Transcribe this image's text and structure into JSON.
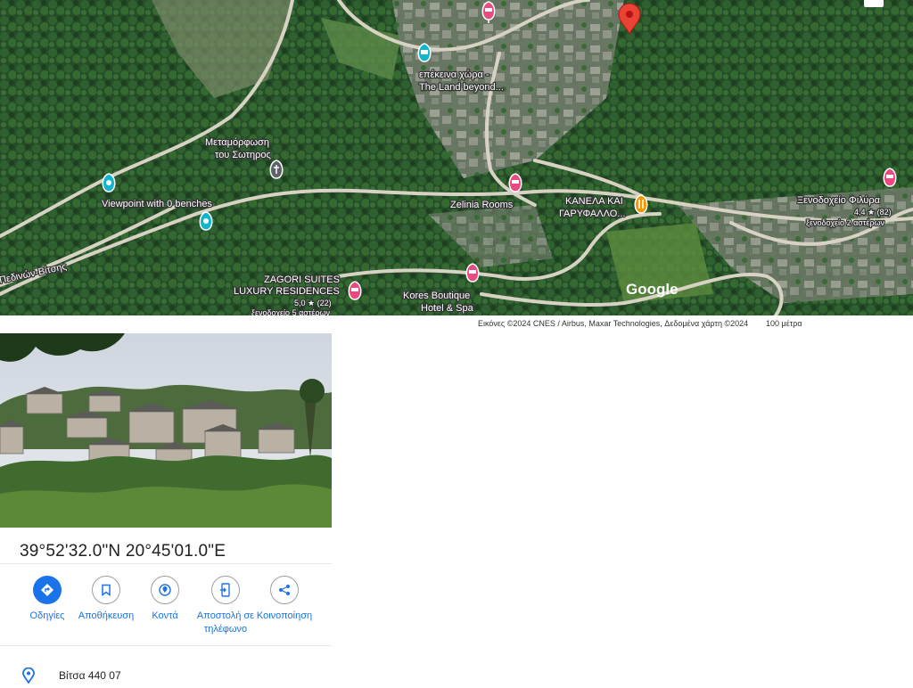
{
  "map": {
    "labels": {
      "metamorfosi_1": "Μεταμόρφωση",
      "metamorfosi_2": "του Σωτηρος",
      "viewpoint": "Viewpoint with 0 benches",
      "road": "Πεδινών-Βίτσης",
      "land_beyond_1": "επέκεινα χώρα -",
      "land_beyond_2": "The Land beyond...",
      "zelinia": "Zelinia Rooms",
      "kanela_1": "ΚΑΝΕΛΑ ΚΑΙ",
      "kanela_2": "ΓΑΡΥΦΑΛΛΟ...",
      "filyra_1": "Ξενοδοχείο Φιλύρα",
      "filyra_2": "4,4 ★ (82)",
      "filyra_3": "ξενοδοχείο 2 αστέρων",
      "zagori_1": "ZAGORI SUITES",
      "zagori_2": "LUXURY RESIDENCES",
      "zagori_3": "5,0 ★ (22)",
      "zagori_4": "ξενοδοχείο 5 αστέρων",
      "kores_1": "Kores Boutique",
      "kores_2": "Hotel & Spa"
    },
    "logo": "Google",
    "colors": {
      "hotel_pin": "#e94a7f",
      "attraction_pin": "#12b5cb",
      "food_pin": "#f29900",
      "selected_pin": "#ea4335",
      "church_pin": "#5f6368"
    }
  },
  "attribution": {
    "imagery": "Εικόνες ©2024 CNES / Airbus, Maxar Technologies, Δεδομένα χάρτη ©2024",
    "scale": "100 μέτρα"
  },
  "place": {
    "coordinates": "39°52'32.0\"N 20°45'01.0\"E",
    "address": "Βίτσα 440 07"
  },
  "actions": [
    {
      "label": "Οδηγίες",
      "icon": "directions-icon"
    },
    {
      "label": "Αποθήκευση",
      "icon": "bookmark-icon"
    },
    {
      "label": "Κοντά",
      "icon": "nearby-icon"
    },
    {
      "label": "Αποστολή σε τηλέφωνο",
      "icon": "send-to-phone-icon"
    },
    {
      "label": "Κοινοποίηση",
      "icon": "share-icon"
    }
  ]
}
